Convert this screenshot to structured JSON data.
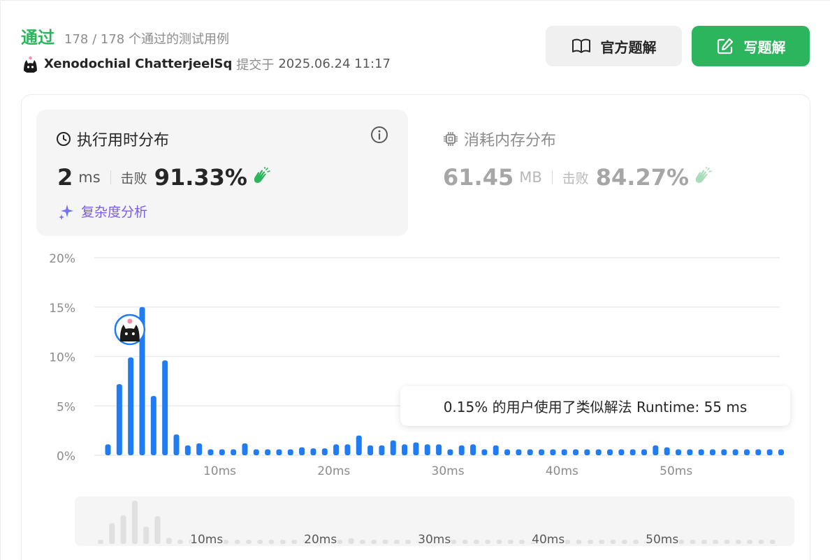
{
  "header": {
    "status": "通过",
    "passed_text": "178 / 178 个通过的测试用例",
    "user": "Xenodochial ChatterjeelSq",
    "submit_label": "提交于",
    "submit_time": "2025.06.24 11:17",
    "official_button": "官方题解",
    "write_button": "写题解"
  },
  "runtime": {
    "title": "执行用时分布",
    "value": "2",
    "unit": "ms",
    "beat_label": "击败",
    "beat_value": "91.33%",
    "complexity_link": "复杂度分析"
  },
  "memory": {
    "title": "消耗内存分布",
    "value": "61.45",
    "unit": "MB",
    "beat_label": "击败",
    "beat_value": "84.27%"
  },
  "tooltip": "0.15% 的用户使用了类似解法 Runtime: 55 ms",
  "colors": {
    "accent_green": "#2db55d",
    "bar_blue": "#1f7cf2",
    "hand_green": "#2db55d",
    "purple": "#7b5ce8"
  },
  "chart_data": {
    "type": "bar",
    "title": "",
    "xlabel": "",
    "ylabel": "",
    "ylim": [
      0,
      20
    ],
    "y_ticks": [
      "0%",
      "5%",
      "10%",
      "15%",
      "20%"
    ],
    "x_ticks": [
      {
        "value": 10,
        "label": "10ms"
      },
      {
        "value": 20,
        "label": "20ms"
      },
      {
        "value": 30,
        "label": "30ms"
      },
      {
        "value": 40,
        "label": "40ms"
      },
      {
        "value": 50,
        "label": "50ms"
      }
    ],
    "x": [
      1,
      2,
      3,
      4,
      5,
      6,
      7,
      8,
      9,
      10,
      11,
      12,
      13,
      14,
      15,
      16,
      17,
      18,
      19,
      20,
      21,
      22,
      23,
      24,
      25,
      26,
      27,
      28,
      29,
      30,
      31,
      32,
      33,
      34,
      35,
      36,
      37,
      38,
      39,
      40,
      41,
      42,
      43,
      44,
      45,
      46,
      47,
      48,
      49,
      50,
      51,
      52,
      53,
      54,
      55,
      56,
      57,
      58,
      59,
      60
    ],
    "values": [
      1.1,
      7.2,
      9.9,
      15.0,
      6.0,
      9.6,
      2.1,
      1.0,
      1.2,
      0.6,
      0.6,
      0.6,
      1.2,
      0.6,
      0.6,
      0.6,
      0.6,
      0.8,
      0.7,
      0.7,
      1.1,
      1.1,
      2.0,
      1.0,
      1.0,
      1.5,
      1.1,
      1.3,
      1.1,
      1.1,
      0.6,
      1.0,
      1.1,
      0.6,
      1.0,
      0.6,
      0.6,
      0.6,
      0.6,
      0.6,
      0.6,
      0.6,
      0.6,
      0.6,
      0.6,
      0.6,
      0.6,
      0.6,
      1.0,
      0.8,
      0.6,
      0.6,
      0.6,
      0.6,
      0.6,
      0.6,
      0.6,
      0.6,
      0.6,
      0.6
    ],
    "user_bar_x": 2,
    "grid": true
  }
}
